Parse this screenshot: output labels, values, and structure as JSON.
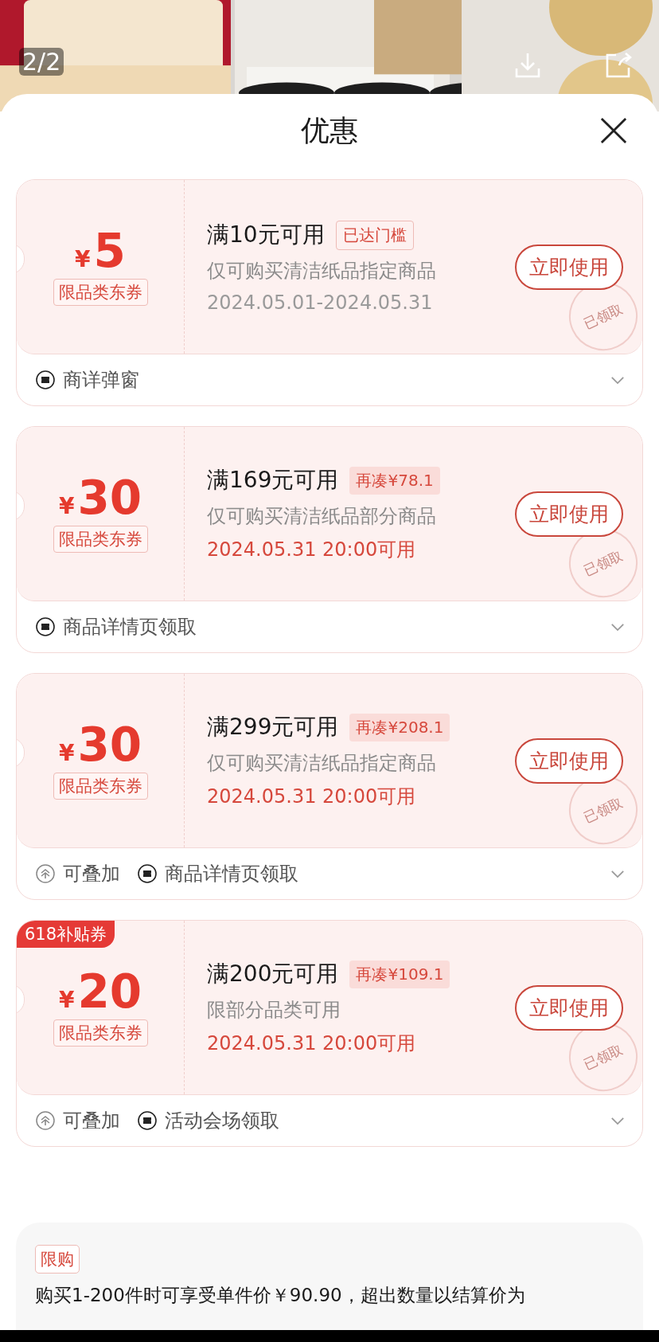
{
  "header": {
    "counter": "2/2",
    "title": "优惠"
  },
  "coupons": [
    {
      "currency": "¥",
      "amount": "5",
      "scope": "限品类东券",
      "condition": "满10元可用",
      "tag": {
        "kind": "reached",
        "text": "已达门槛"
      },
      "desc": "仅可购买清洁纸品指定商品",
      "validity": {
        "kind": "range",
        "text": "2024.05.01-2024.05.31"
      },
      "button": "立即使用",
      "stamp": "已领取",
      "expanded": false,
      "footer": [
        {
          "kind": "ticket",
          "text": "商详弹窗"
        }
      ]
    },
    {
      "currency": "¥",
      "amount": "30",
      "scope": "限品类东券",
      "condition": "满169元可用",
      "tag": {
        "kind": "gap",
        "text": "再凑¥78.1"
      },
      "desc": "仅可购买清洁纸品部分商品",
      "validity": {
        "kind": "upcoming",
        "text": "2024.05.31 20:00可用"
      },
      "button": "立即使用",
      "stamp": "已领取",
      "expanded": false,
      "footer": [
        {
          "kind": "ticket",
          "text": "商品详情页领取"
        }
      ]
    },
    {
      "currency": "¥",
      "amount": "30",
      "scope": "限品类东券",
      "condition": "满299元可用",
      "tag": {
        "kind": "gap",
        "text": "再凑¥208.1"
      },
      "desc": "仅可购买清洁纸品指定商品",
      "validity": {
        "kind": "upcoming",
        "text": "2024.05.31 20:00可用"
      },
      "button": "立即使用",
      "stamp": "已领取",
      "expanded": false,
      "footer": [
        {
          "kind": "stack",
          "text": "可叠加"
        },
        {
          "kind": "ticket",
          "text": "商品详情页领取"
        }
      ]
    },
    {
      "badge": "618补贴券",
      "currency": "¥",
      "amount": "20",
      "scope": "限品类东券",
      "condition": "满200元可用",
      "tag": {
        "kind": "gap",
        "text": "再凑¥109.1"
      },
      "desc": "限部分品类可用",
      "validity": {
        "kind": "upcoming",
        "text": "2024.05.31 20:00可用"
      },
      "button": "立即使用",
      "stamp": "已领取",
      "expanded": false,
      "footer": [
        {
          "kind": "stack",
          "text": "可叠加"
        },
        {
          "kind": "ticket",
          "text": "活动会场领取"
        }
      ]
    }
  ],
  "limit": {
    "tag": "限购",
    "text": "购买1-200件时可享受单件价￥90.90，超出数量以结算价为"
  }
}
